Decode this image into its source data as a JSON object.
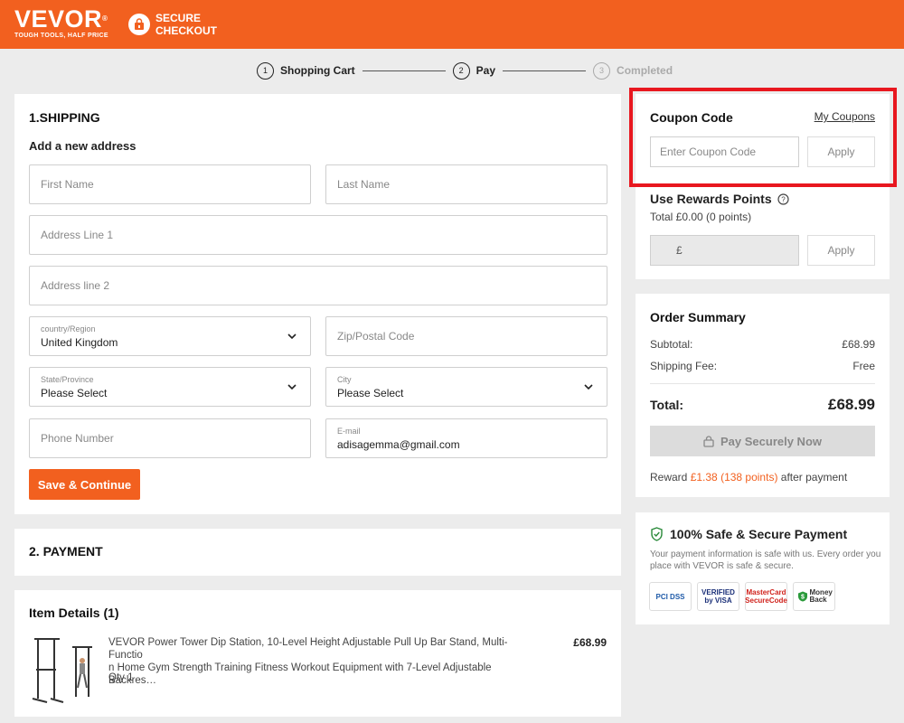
{
  "header": {
    "logo": "VEVOR",
    "logo_mark": "®",
    "logo_tagline": "TOUGH TOOLS, HALF PRICE",
    "secure_line1": "SECURE",
    "secure_line2": "CHECKOUT"
  },
  "steps": [
    {
      "num": "1",
      "label": "Shopping Cart"
    },
    {
      "num": "2",
      "label": "Pay"
    },
    {
      "num": "3",
      "label": "Completed"
    }
  ],
  "shipping": {
    "title": "1.SHIPPING",
    "subtitle": "Add a new address",
    "first_name": "First Name",
    "last_name": "Last Name",
    "address1": "Address Line 1",
    "address2": "Address line 2",
    "country_label": "country/Region",
    "country_value": "United Kingdom",
    "zip": "Zip/Postal Code",
    "state_label": "State/Province",
    "state_value": "Please Select",
    "city_label": "City",
    "city_value": "Please Select",
    "phone": "Phone Number",
    "email_label": "E-mail",
    "email_value": "adisagemma@gmail.com",
    "save_button": "Save & Continue"
  },
  "payment": {
    "title": "2. PAYMENT"
  },
  "items": {
    "title": "Item Details (1)",
    "product_line1": "VEVOR Power Tower Dip Station, 10-Level Height Adjustable Pull Up Bar Stand, Multi-Functio",
    "product_line2": "n Home Gym Strength Training Fitness Workout Equipment with 7-Level Adjustable Backres…",
    "qty": "Qty 1",
    "price": "£68.99"
  },
  "coupon": {
    "title": "Coupon Code",
    "my_coupons": "My Coupons",
    "placeholder": "Enter Coupon Code",
    "apply": "Apply"
  },
  "rewards": {
    "title": "Use Rewards Points",
    "total": "Total £0.00 (0 points)",
    "currency": "£",
    "apply": "Apply"
  },
  "summary": {
    "title": "Order Summary",
    "subtotal_label": "Subtotal:",
    "subtotal_value": "£68.99",
    "shipping_label": "Shipping Fee:",
    "shipping_value": "Free",
    "total_label": "Total:",
    "total_value": "£68.99",
    "pay_button": "Pay Securely Now",
    "reward_prefix": "Reward",
    "reward_amount": "£1.38 (138 points)",
    "reward_suffix": "after payment"
  },
  "safe": {
    "title": "100% Safe & Secure Payment",
    "text_line1": "Your payment information is safe with us. Every order you",
    "text_line2": "place with VEVOR is safe & secure.",
    "badge_pci": "PCI DSS",
    "badge_visa": "VERIFIED by VISA",
    "badge_mc": "MasterCard SecureCode",
    "badge_money": "Money Back"
  },
  "colors": {
    "brand": "#f2601f",
    "highlight": "#e8171f",
    "reward": "#f2601f"
  }
}
